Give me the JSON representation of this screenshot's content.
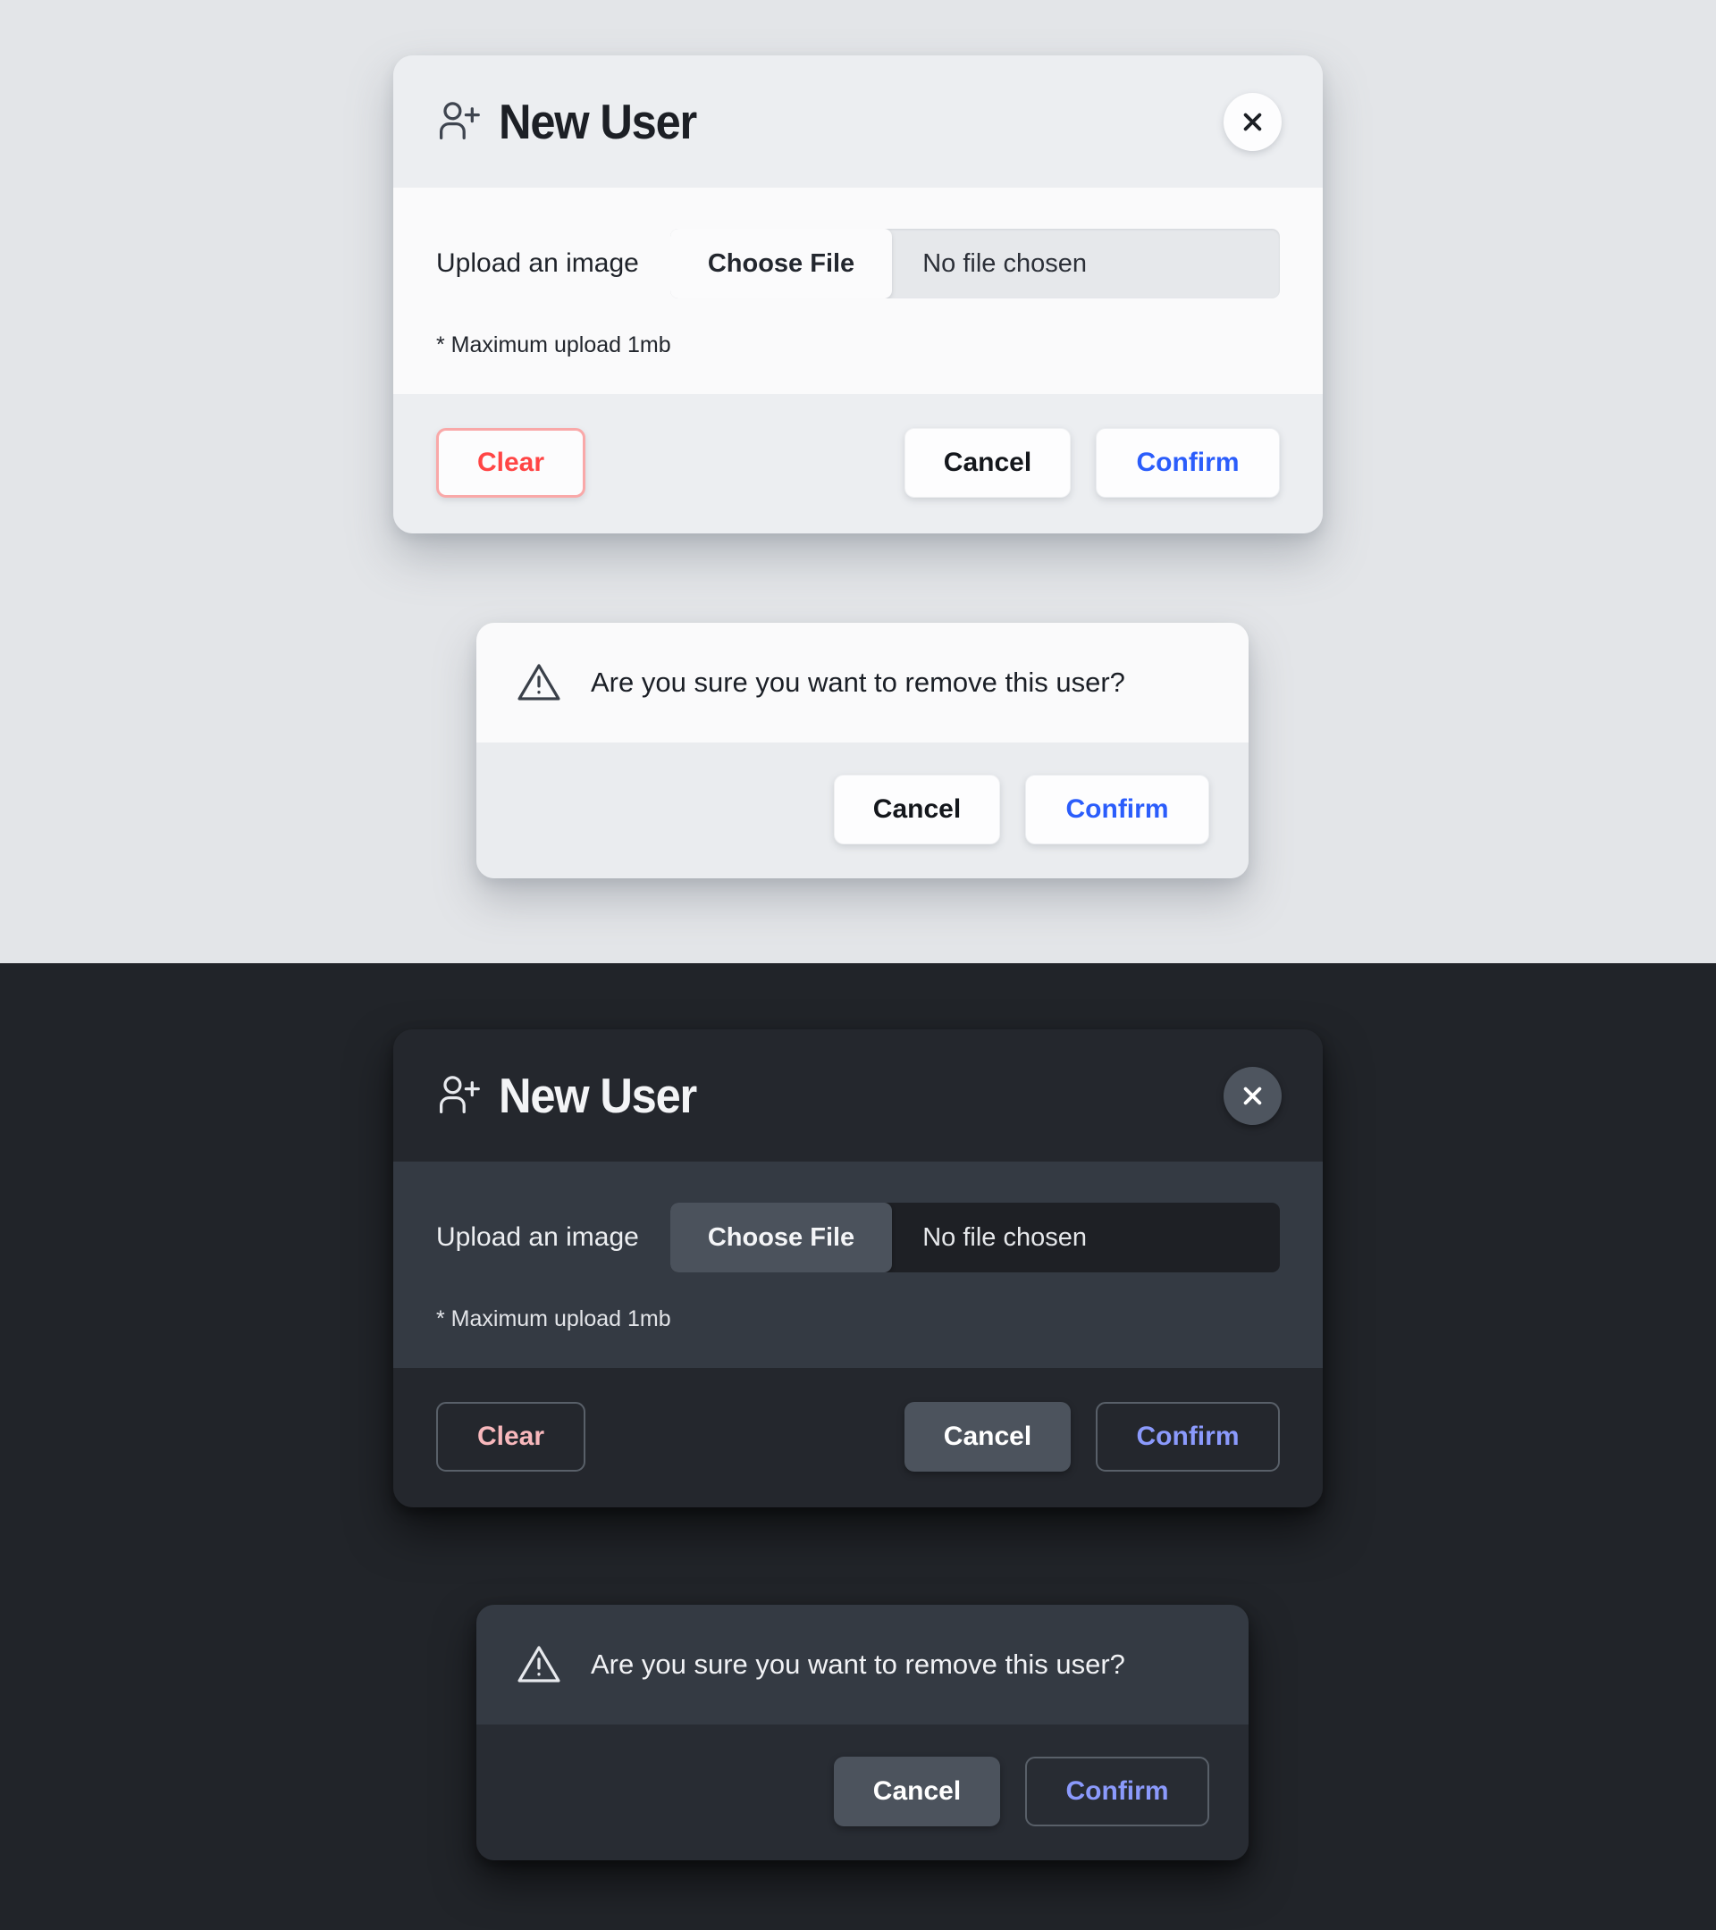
{
  "themes": {
    "light": {
      "modal": {
        "icon": "person-add-icon",
        "title": "New User",
        "close_icon": "close-icon",
        "upload_label": "Upload an image",
        "choose_file_label": "Choose File",
        "file_name": "No file chosen",
        "hint": "* Maximum upload 1mb",
        "clear_label": "Clear",
        "cancel_label": "Cancel",
        "confirm_label": "Confirm"
      },
      "dialog": {
        "warn_icon": "warning-triangle-icon",
        "message": "Are you sure you want to remove this user?",
        "cancel_label": "Cancel",
        "confirm_label": "Confirm"
      }
    },
    "dark": {
      "modal": {
        "icon": "person-add-icon",
        "title": "New User",
        "close_icon": "close-icon",
        "upload_label": "Upload an image",
        "choose_file_label": "Choose File",
        "file_name": "No file chosen",
        "hint": "* Maximum upload 1mb",
        "clear_label": "Clear",
        "cancel_label": "Cancel",
        "confirm_label": "Confirm"
      },
      "dialog": {
        "warn_icon": "warning-triangle-icon",
        "message": "Are you sure you want to remove this user?",
        "cancel_label": "Cancel",
        "confirm_label": "Confirm"
      }
    }
  },
  "colors": {
    "light_background": "#e3e5e8",
    "dark_background": "#212429",
    "light_surface": "#fafafb",
    "light_chrome": "#eceef1",
    "dark_surface": "#343a43",
    "dark_chrome": "#24272d",
    "danger_light": "#ff4545",
    "danger_dark": "#f8b8bc",
    "accent_light": "#2b5dfb",
    "accent_dark": "#8b9afc"
  }
}
